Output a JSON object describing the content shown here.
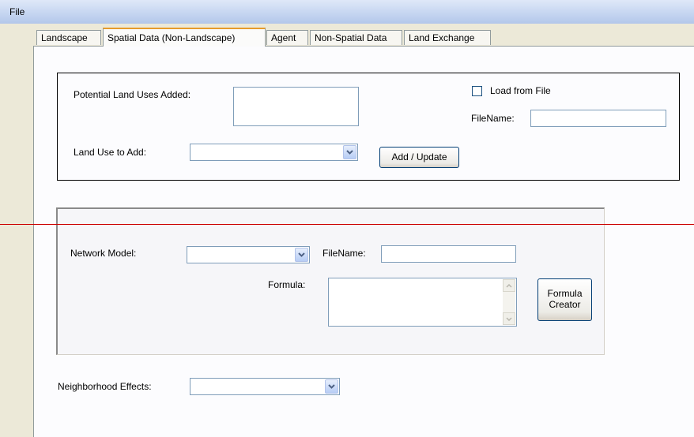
{
  "menubar": {
    "file": "File"
  },
  "tabs": [
    {
      "label": "Landscape"
    },
    {
      "label": "Spatial Data (Non-Landscape)"
    },
    {
      "label": "Agent"
    },
    {
      "label": "Non-Spatial Data"
    },
    {
      "label": "Land Exchange"
    }
  ],
  "land_use_group": {
    "potential_label": "Potential Land Uses Added:",
    "potential_value": "",
    "land_use_label": "Land Use to Add:",
    "land_use_value": "",
    "add_update_label": "Add / Update",
    "load_from_file_label": "Load from File",
    "load_from_file_checked": false,
    "filename_label": "FileName:",
    "filename_value": ""
  },
  "network_group": {
    "network_model_label": "Network Model:",
    "network_model_value": "",
    "filename_label": "FileName:",
    "filename_value": "",
    "formula_label": "Formula:",
    "formula_value": "",
    "formula_creator_label_line1": "Formula",
    "formula_creator_label_line2": "Creator"
  },
  "neighborhood": {
    "label": "Neighborhood Effects:",
    "value": ""
  },
  "colors": {
    "accent_tab": "#e69b2c",
    "overlay_line": "#cc0000",
    "input_border": "#7f9db9"
  },
  "icons": {
    "dropdown": "chevron-down-icon",
    "scroll_up": "scroll-up-arrow-icon",
    "scroll_down": "scroll-down-arrow-icon"
  }
}
